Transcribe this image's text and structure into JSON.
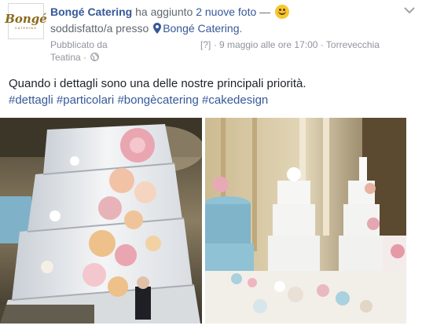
{
  "post": {
    "page_name": "Bongé Catering",
    "action": "ha aggiunto",
    "photos_link": "2 nuove foto",
    "dash": "—",
    "feeling": "soddisfatto/a presso",
    "location": "Bongé Catering",
    "location_period": ".",
    "published_from": "Pubblicato da",
    "published_from_2": "Teatina",
    "separator": "·",
    "bracket": "[?]",
    "date": "9 maggio alle ore 17:00",
    "place": "Torrevecchia",
    "text": "Quando i dettagli sono una delle nostre principali priorità.",
    "hashtags": [
      "#dettagli",
      "#particolari",
      "#bongècatering",
      "#cakedesign"
    ]
  },
  "avatar": {
    "logo": "Bongé",
    "sub": "CATERING"
  },
  "icons": {
    "feeling": "smiley-icon",
    "location": "pin-icon",
    "privacy": "globe-icon",
    "menu": "chevron-down-icon"
  },
  "colors": {
    "link": "#365899",
    "meta": "#90949c",
    "text": "#1d2129",
    "smiley": "#f7c531"
  }
}
